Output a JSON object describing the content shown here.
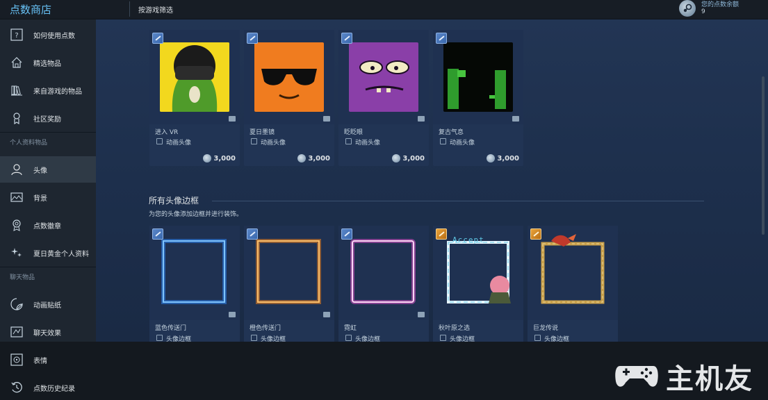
{
  "header": {
    "store_title": "点数商店",
    "filter_label": "按游戏筛选",
    "balance_label": "您的点数余额",
    "balance_value": "9"
  },
  "sidebar": {
    "items": [
      {
        "label": "如何使用点数",
        "icon": "question-icon"
      },
      {
        "label": "精选物品",
        "icon": "home-icon"
      },
      {
        "label": "来自游戏的物品",
        "icon": "library-icon"
      },
      {
        "label": "社区奖励",
        "icon": "trophy-icon"
      }
    ],
    "section_profile": "个人资料物品",
    "profile_items": [
      {
        "label": "头像",
        "icon": "avatar-icon",
        "active": true
      },
      {
        "label": "背景",
        "icon": "background-icon"
      },
      {
        "label": "点数徽章",
        "icon": "badge-icon"
      },
      {
        "label": "夏日黄金个人资料",
        "icon": "sparkle-icon"
      }
    ],
    "section_chat": "聊天物品",
    "chat_items": [
      {
        "label": "动画贴纸",
        "icon": "sticker-icon"
      },
      {
        "label": "聊天效果",
        "icon": "chat-effect-icon"
      }
    ]
  },
  "bottom": {
    "items": [
      {
        "label": "表情",
        "icon": "emoticon-icon"
      },
      {
        "label": "点数历史纪录",
        "icon": "history-icon"
      }
    ],
    "watermark": "主机友"
  },
  "avatars": [
    {
      "name": "进入 VR",
      "type": "动画头像",
      "price": "3,000",
      "colors": {
        "bg": "#f0d020",
        "main": "#4c9a2e"
      }
    },
    {
      "name": "夏日墨镜",
      "type": "动画头像",
      "price": "3,000",
      "colors": {
        "bg": "#f07820",
        "main": "#111111"
      }
    },
    {
      "name": "眨眨眼",
      "type": "动画头像",
      "price": "3,000",
      "colors": {
        "bg": "#8a3fa8",
        "main": "#f0e8c0"
      }
    },
    {
      "name": "复古气息",
      "type": "动画头像",
      "price": "3,000",
      "colors": {
        "bg": "#060806",
        "main": "#39c43a"
      }
    }
  ],
  "frames_section": {
    "title": "所有头像边框",
    "subtitle": "为您的头像添加边框并进行装饰。"
  },
  "frames": [
    {
      "name": "蓝色传送门",
      "type": "头像边框",
      "color": "#2f8cff"
    },
    {
      "name": "橙色传送门",
      "type": "头像边框",
      "color": "#ff8a1a"
    },
    {
      "name": "霓虹",
      "type": "头像边框",
      "color": "#ff5ae0"
    },
    {
      "name": "秋叶原之选",
      "type": "头像边框",
      "color": "#d9f3ff",
      "overlay_text": "Accept"
    },
    {
      "name": "巨龙传说",
      "type": "头像边框",
      "color": "#c9a04a"
    }
  ]
}
